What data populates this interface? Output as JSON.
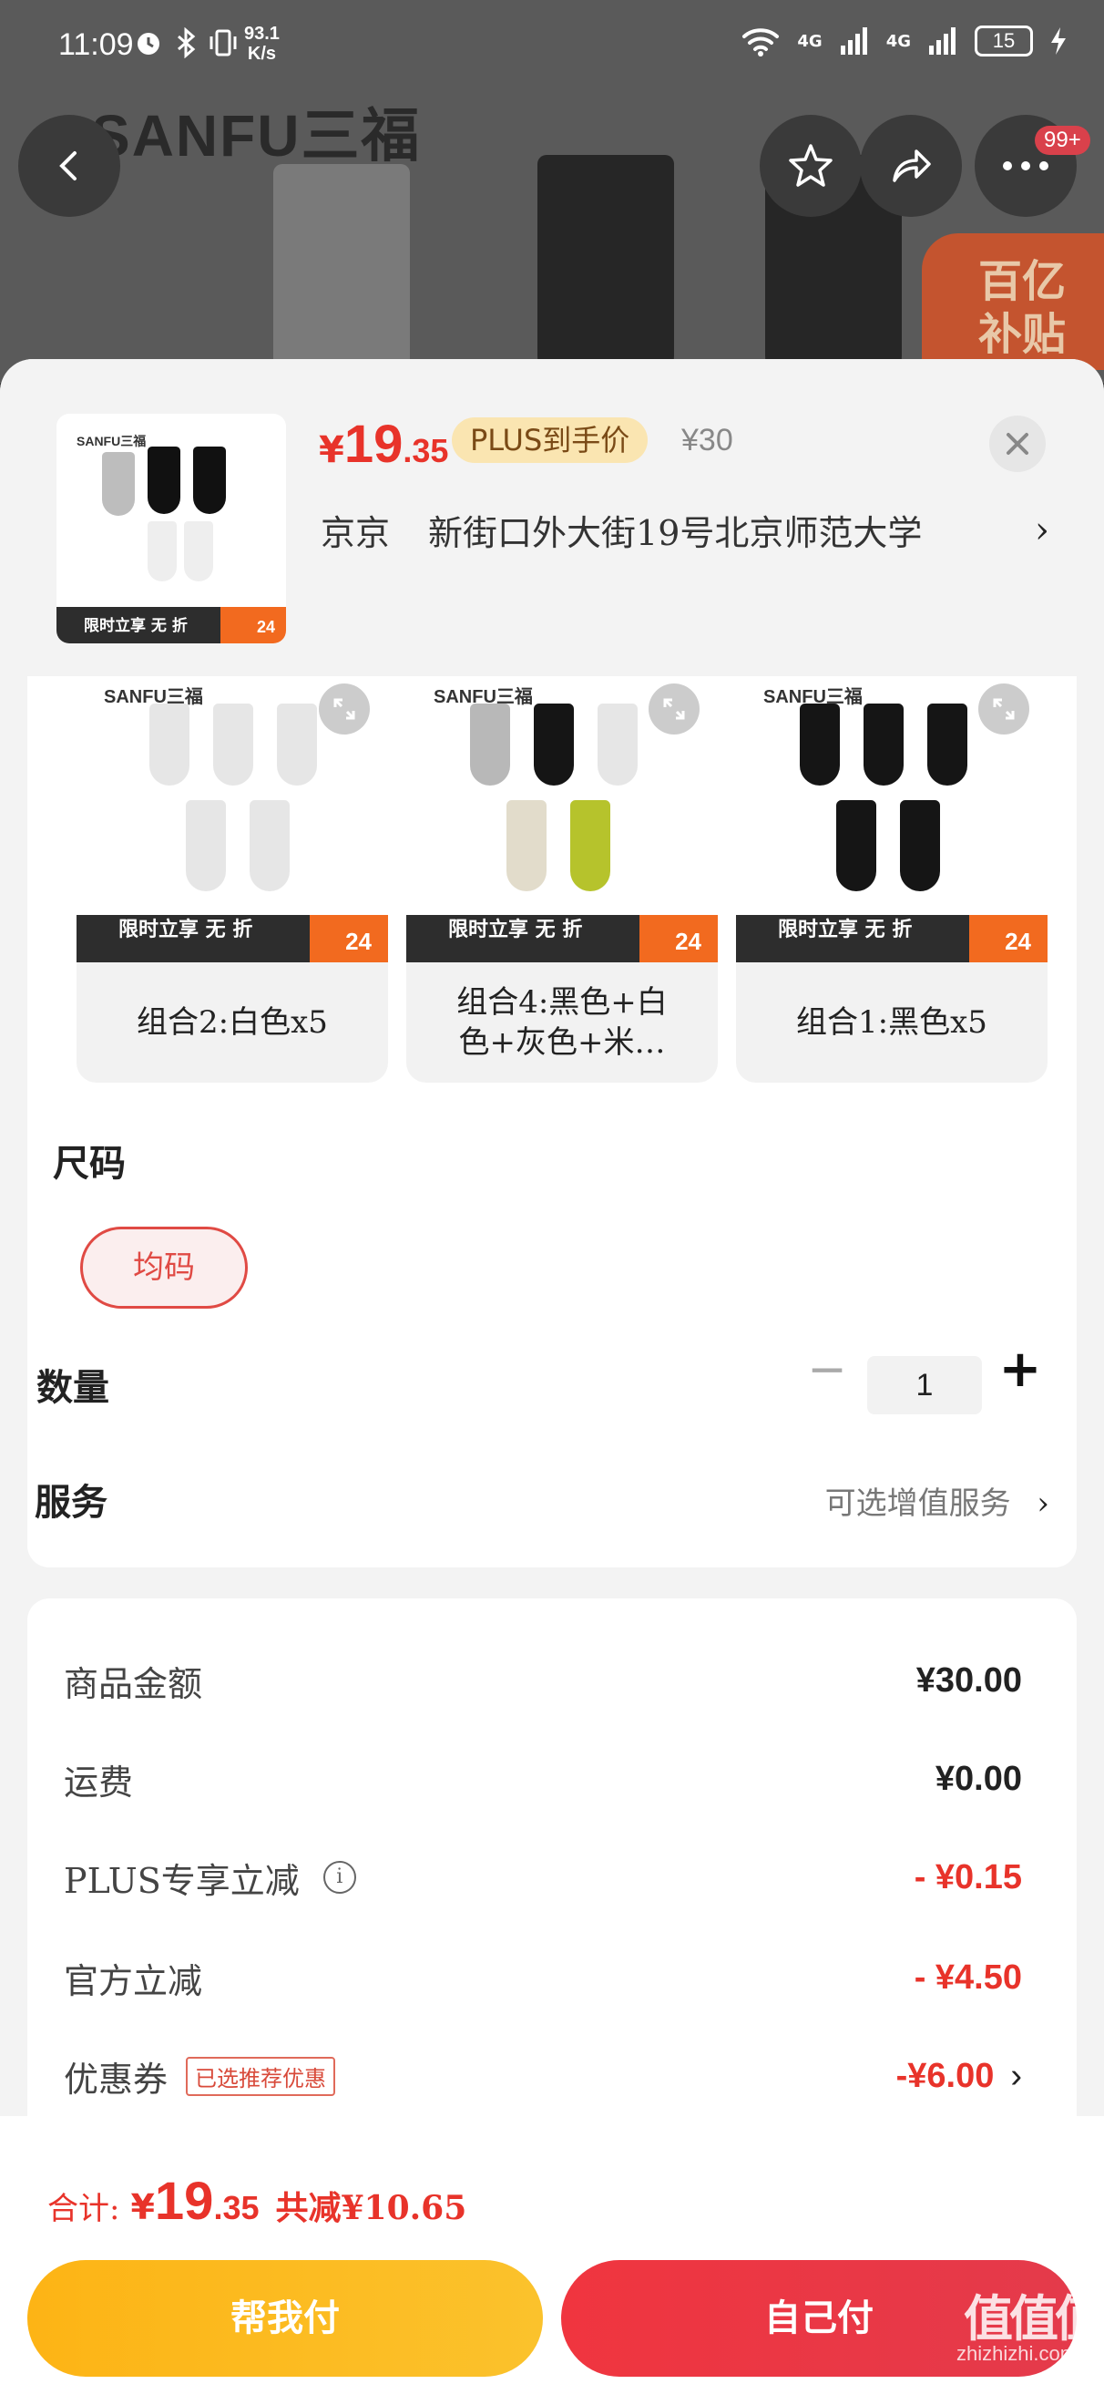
{
  "status_bar": {
    "time": "11:09",
    "net_speed_value": "93.1",
    "net_speed_unit": "K/s",
    "signal_1": "4G",
    "signal_2": "4G",
    "battery": "15"
  },
  "background": {
    "brand_logo": "SANFU三福",
    "more_badge": "99+",
    "subsidy_line1": "百亿",
    "subsidy_line2": "补贴"
  },
  "product": {
    "price_yen": "¥",
    "price_int": "19",
    "price_dec": ".35",
    "plus_badge": "PLUS到手价",
    "original_price": "¥30",
    "thumb_brand": "SANFU三福",
    "thumb_promo": "限时立享 无 折",
    "thumb_promo_num": "24"
  },
  "address": {
    "city": "京京",
    "detail": "新街口外大街19号北京师范大学"
  },
  "variants": [
    {
      "label": "组合2:白色x5",
      "brand": "SANFU三福",
      "promo": "限时立享 无 折",
      "promo_num": "24"
    },
    {
      "label": "组合4:黑色+白色+灰色+米…",
      "brand": "SANFU三福",
      "promo": "限时立享 无 折",
      "promo_num": "24"
    },
    {
      "label": "组合1:黑色x5",
      "brand": "SANFU三福",
      "promo": "限时立享 无 折",
      "promo_num": "24"
    }
  ],
  "size": {
    "title": "尺码",
    "selected": "均码"
  },
  "quantity": {
    "title": "数量",
    "minus": "−",
    "value": "1",
    "plus": "+"
  },
  "service": {
    "title": "服务",
    "value": "可选增值服务",
    "chevron": "›"
  },
  "summary": {
    "rows": [
      {
        "label": "商品金额",
        "value": "¥30.00"
      },
      {
        "label": "运费",
        "value": "¥0.00"
      },
      {
        "label": "PLUS专享立减",
        "value": "- ¥0.15",
        "info": "i"
      },
      {
        "label": "官方立减",
        "value": "- ¥4.50"
      },
      {
        "label": "优惠券",
        "value": "-¥6.00",
        "tag": "已选推荐优惠"
      }
    ]
  },
  "footer": {
    "total_label": "合计:",
    "total_yen": "¥",
    "total_int": "19",
    "total_dec": ".35",
    "total_saved": "共减¥10.65",
    "help_pay": "帮我付",
    "self_pay": "自己付",
    "watermark": "zhizhizhi.com",
    "watermark_logo": "值值值"
  },
  "colors": {
    "accent_red": "#e8332a",
    "plus_gold": "#fae5b1",
    "help_btn": "#fdb415",
    "self_btn": "#f0353f"
  }
}
